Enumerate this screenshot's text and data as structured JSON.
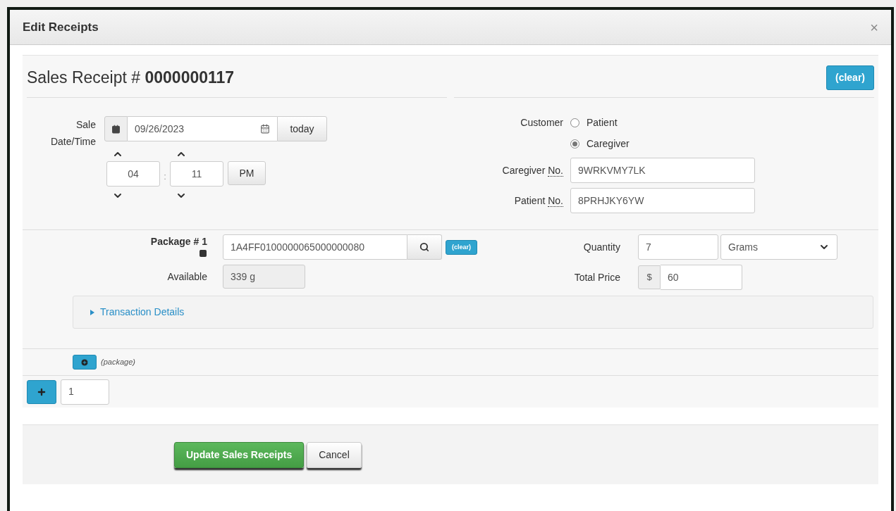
{
  "dialog": {
    "title": "Edit Receipts",
    "close": "×"
  },
  "receipt": {
    "label": "Sales Receipt #",
    "number": "0000000117",
    "clear": "(clear)"
  },
  "sale": {
    "label": "Sale Date/Time",
    "date": "09/26/2023",
    "today": "today",
    "hour": "04",
    "separator": ":",
    "minute": "11",
    "meridiem": "PM"
  },
  "customer": {
    "label": "Customer",
    "options": [
      {
        "label": "Patient",
        "selected": false
      },
      {
        "label": "Caregiver",
        "selected": true
      }
    ]
  },
  "ids": [
    {
      "label": "Caregiver",
      "abbr": "No.",
      "value": "9WRKVMY7LK"
    },
    {
      "label": "Patient",
      "abbr": "No.",
      "value": "8PRHJKY6YW"
    }
  ],
  "package": {
    "label": "Package # 1",
    "value": "1A4FF0100000065000000080",
    "clear": "(clear)",
    "available_label": "Available",
    "available": "339 g",
    "quantity_label": "Quantity",
    "quantity": "7",
    "unit": "Grams",
    "price_label": "Total Price",
    "currency": "$",
    "price": "60"
  },
  "transaction_details": {
    "label": "Transaction Details",
    "expanded": false
  },
  "add_package": {
    "label": "(package)"
  },
  "add_rows": {
    "count": "1"
  },
  "buttons": {
    "update": "Update Sales Receipts",
    "cancel": "Cancel"
  }
}
